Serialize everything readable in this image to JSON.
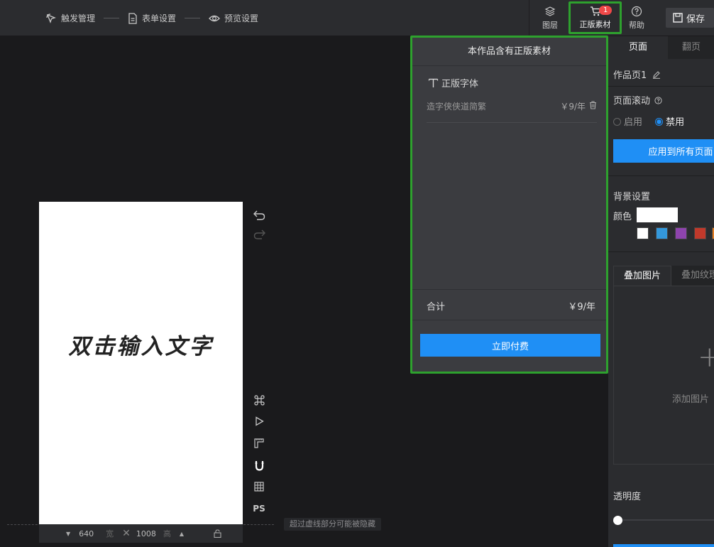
{
  "topbar": {
    "steps": [
      "触发管理",
      "表单设置",
      "预览设置"
    ],
    "layers_label": "图层",
    "cart_label": "正版素材",
    "cart_badge": "1",
    "help_label": "帮助",
    "save_label": "保存"
  },
  "canvas": {
    "text": "双击输入文字",
    "width": "640",
    "width_label": "宽",
    "height": "1008",
    "height_label": "高",
    "hint": "超过虚线部分可能被隐藏",
    "ps_label": "PS"
  },
  "popover": {
    "title": "本作品含有正版素材",
    "section_title": "正版字体",
    "items": [
      {
        "name": "造字侠侠道简繁",
        "price": "￥9/年"
      }
    ],
    "total_label": "合计",
    "total_value": "￥9/年",
    "pay_label": "立即付费"
  },
  "right_panel": {
    "tab_page": "页面",
    "tab_flip": "翻页",
    "page_name": "作品页1",
    "scroll_label": "页面滚动",
    "opt_enable": "启用",
    "opt_disable": "禁用",
    "apply_label": "应用到所有页面",
    "bg_label": "背景设置",
    "color_label": "颜色",
    "swatch_colors": [
      "#ffffff",
      "#3498db",
      "#8e44ad",
      "#c0392b",
      "#e67e22"
    ],
    "img_tab_active": "叠加图片",
    "img_tab_other": "叠加纹理",
    "add_image": "添加图片",
    "opacity_label": "透明度"
  }
}
